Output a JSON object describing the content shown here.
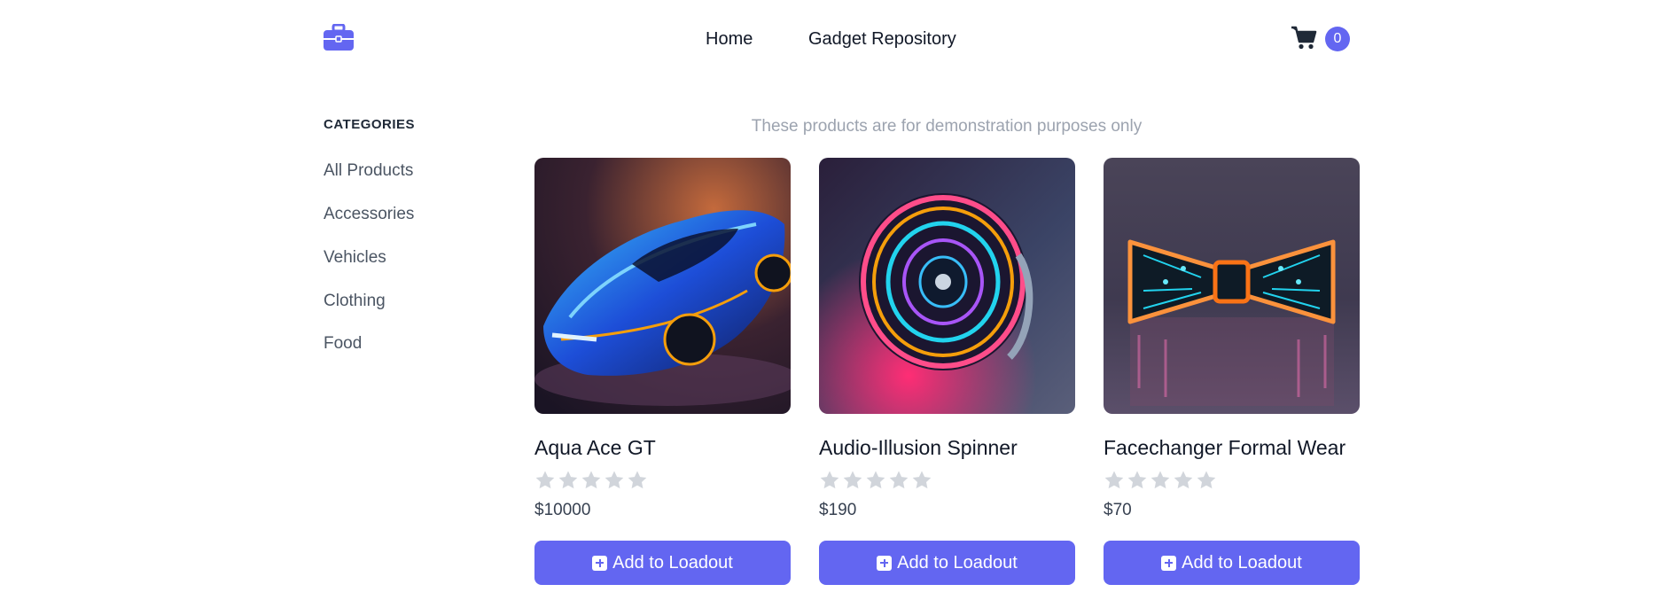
{
  "header": {
    "nav": [
      {
        "label": "Home"
      },
      {
        "label": "Gadget Repository"
      }
    ],
    "cart_count": "0",
    "brand_color": "#6366f1"
  },
  "sidebar": {
    "title": "CATEGORIES",
    "items": [
      {
        "label": "All Products"
      },
      {
        "label": "Accessories"
      },
      {
        "label": "Vehicles"
      },
      {
        "label": "Clothing"
      },
      {
        "label": "Food"
      }
    ]
  },
  "notice": "These products are for demonstration purposes only",
  "products": [
    {
      "name": "Aqua Ace GT",
      "price": "$10000",
      "rating": 0,
      "button_label": "Add to Loadout",
      "image": "neon-sports-car"
    },
    {
      "name": "Audio-Illusion Spinner",
      "price": "$190",
      "rating": 0,
      "button_label": "Add to Loadout",
      "image": "neon-spinner-disc"
    },
    {
      "name": "Facechanger Formal Wear",
      "price": "$70",
      "rating": 0,
      "button_label": "Add to Loadout",
      "image": "neon-bow-tie"
    }
  ]
}
